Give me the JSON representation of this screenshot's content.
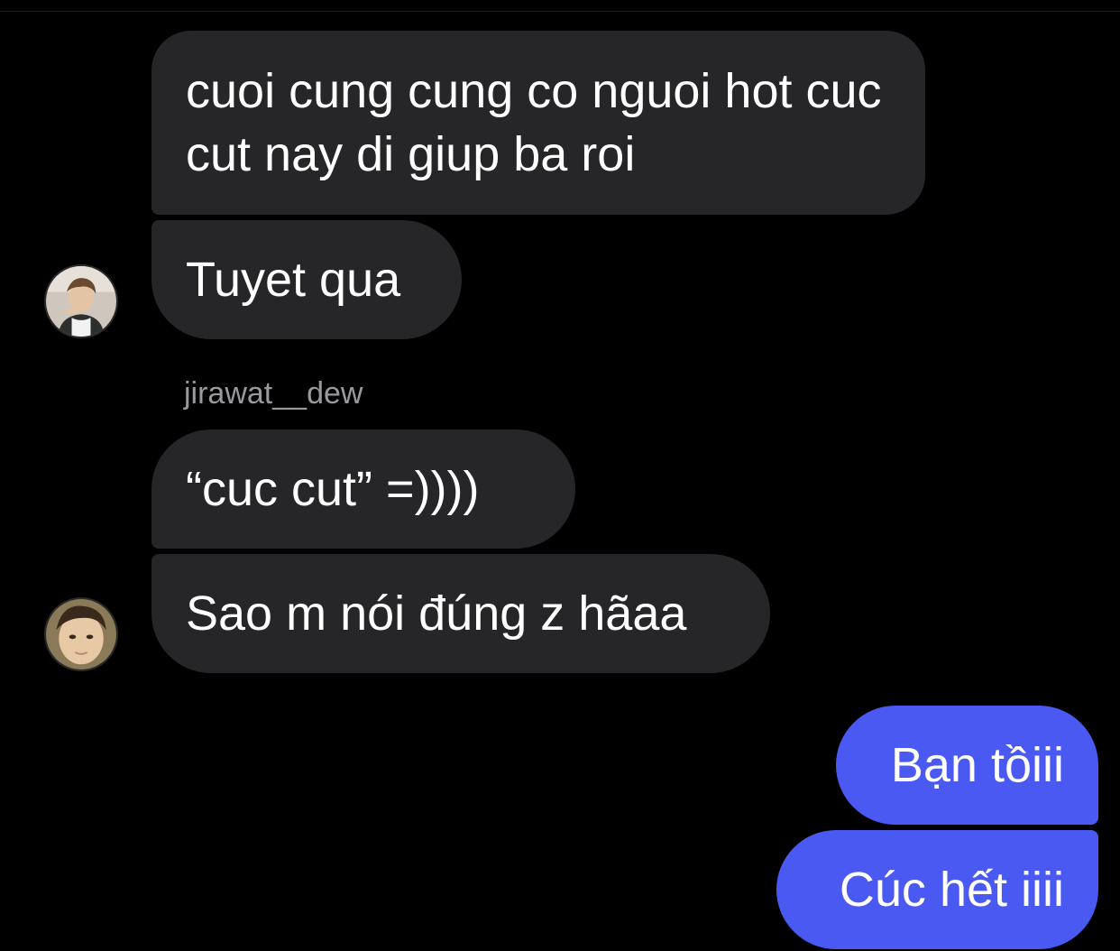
{
  "conversation": {
    "messages": [
      {
        "direction": "incoming",
        "text": "cuoi cung cung co nguoi hot cuc cut nay di giup ba roi"
      },
      {
        "direction": "incoming",
        "text": "Tuyet qua"
      },
      {
        "direction": "incoming",
        "text": "“cuc cut” =))))",
        "sender": "jirawat__dew"
      },
      {
        "direction": "incoming",
        "text": "Sao m nói đúng z hãaa"
      },
      {
        "direction": "outgoing",
        "text": "Bạn tồiii"
      },
      {
        "direction": "outgoing",
        "text": "Cúc hết iiii"
      }
    ],
    "avatars": [
      {
        "icon": "user-avatar-photo-icon"
      },
      {
        "icon": "user-avatar-photo-icon"
      }
    ]
  },
  "colors": {
    "background": "#000000",
    "incoming_bubble": "#262628",
    "outgoing_bubble": "#4a59f2",
    "sender_name": "#9a9a9e"
  }
}
